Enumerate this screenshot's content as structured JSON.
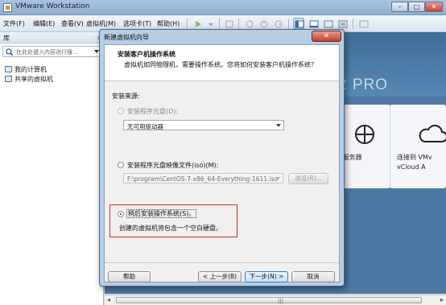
{
  "window": {
    "title": "VMware Workstation",
    "min": "–",
    "max": "□",
    "close": "✕"
  },
  "menu": [
    "文件(F)",
    "编辑(E)",
    "查看(V)",
    "虚拟机(M)",
    "选项卡(T)",
    "帮助(H)"
  ],
  "library": {
    "title": "库",
    "search_placeholder": "在此处键入内容进行搜...",
    "items": [
      "我的计算机",
      "共享的虚拟机"
    ],
    "resize_glyph": "▼"
  },
  "home": {
    "brand_fragment": "2 PRO",
    "tile_remote_label": "服务器",
    "tile_vcloud_label": "连接到 VMv\nvCloud A"
  },
  "dialog": {
    "title": "新建虚拟机向导",
    "close": "✕",
    "heading": "安装客户机操作系统",
    "subheading": "虚拟机如同物理机，需要操作系统。您将如何安装客户机操作系统？",
    "source_label": "安装来源:",
    "disc_option": "安装程序光盘(D):",
    "disc_value": "无可用驱动器",
    "iso_option": "安装程序光盘映像文件(iso)(M):",
    "iso_path": "F:\\program\\CentOS-7-x86_64-Everything-1611.iso",
    "browse": "浏览(R)...",
    "later_option": "稍后安装操作系统(S)。",
    "later_desc": "创建的虚拟机将包含一个空白硬盘。",
    "help": "帮助",
    "back": "< 上一步(B)",
    "next": "下一步(N) >",
    "cancel": "取消"
  },
  "colors": {
    "highlight": "#d42b2b",
    "banner": "#3f6e98",
    "dialog_frame": "#b6cde4"
  }
}
